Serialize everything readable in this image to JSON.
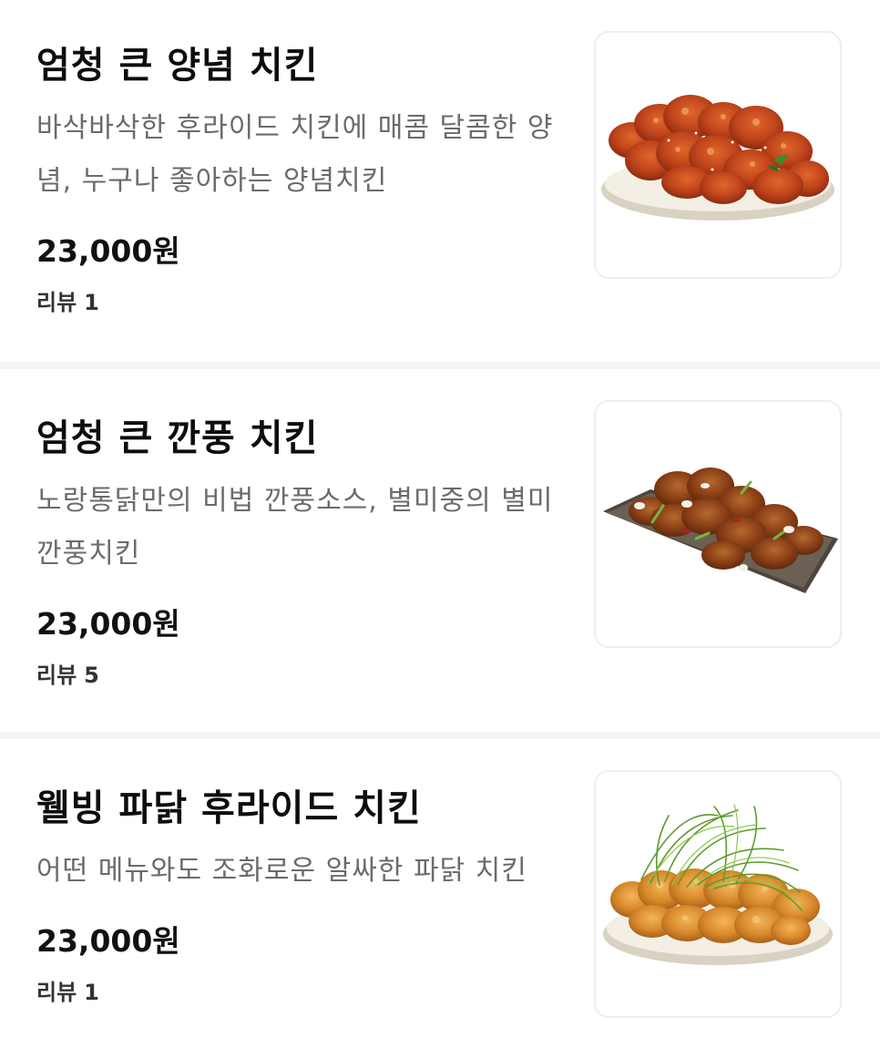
{
  "menu": {
    "items": [
      {
        "name": "엄청 큰 양념 치킨",
        "description": "바삭바삭한 후라이드 치킨에 매콤 달콤한 양념, 누구나 좋아하는 양념치킨",
        "price": "23,000원",
        "review_label": "리뷰",
        "review_count": "1",
        "image": "seasoned-chicken-photo"
      },
      {
        "name": "엄청 큰 깐풍 치킨",
        "description": "노랑통닭만의 비법 깐풍소스, 별미중의 별미 깐풍치킨",
        "price": "23,000원",
        "review_label": "리뷰",
        "review_count": "5",
        "image": "kkanpung-chicken-photo"
      },
      {
        "name": "웰빙 파닭 후라이드 치킨",
        "description": "어떤 메뉴와도 조화로운 알싸한 파닭 치킨",
        "price": "23,000원",
        "review_label": "리뷰",
        "review_count": "1",
        "image": "green-onion-fried-chicken-photo"
      }
    ]
  },
  "colors": {
    "divider": "#f3f4f5",
    "description": "#6b6b6b",
    "title": "#0d0d0d",
    "seasoned_sauce": "#c0441c",
    "kkanpung_sauce": "#8a3f17",
    "fried_golden": "#d98a2b",
    "green_onion": "#5f9a2c"
  }
}
